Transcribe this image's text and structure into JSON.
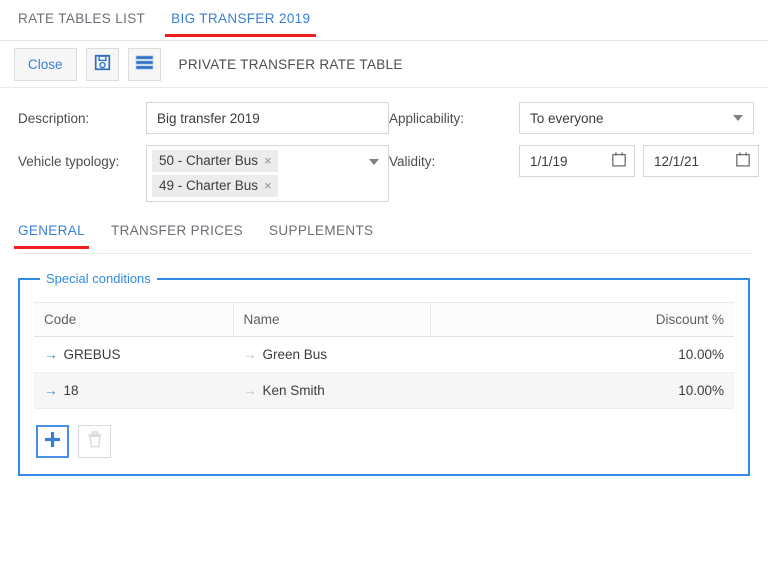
{
  "top_tabs": [
    {
      "label": "RATE TABLES LIST",
      "active": false
    },
    {
      "label": "BIG TRANSFER 2019",
      "active": true
    }
  ],
  "toolbar": {
    "close_label": "Close",
    "save_icon": "save-floppy-icon",
    "menu_icon": "hamburger-menu-icon",
    "title": "PRIVATE TRANSFER RATE TABLE"
  },
  "form": {
    "description_label": "Description:",
    "description_value": "Big transfer 2019",
    "vehicle_typology_label": "Vehicle typology:",
    "vehicle_chips": [
      {
        "label": "50 - Charter Bus",
        "remove": "×"
      },
      {
        "label": "49 - Charter Bus",
        "remove": "×"
      }
    ],
    "applicability_label": "Applicability:",
    "applicability_value": "To everyone",
    "validity_label": "Validity:",
    "validity_from": "1/1/19",
    "validity_to": "12/1/21"
  },
  "inner_tabs": [
    {
      "label": "GENERAL",
      "active": true
    },
    {
      "label": "TRANSFER PRICES",
      "active": false
    },
    {
      "label": "SUPPLEMENTS",
      "active": false
    }
  ],
  "special_conditions": {
    "legend": "Special conditions",
    "columns": [
      "Code",
      "Name",
      "",
      "Discount %"
    ],
    "rows": [
      {
        "code": "GREBUS",
        "name": "Green Bus",
        "discount": "10.00%"
      },
      {
        "code": "18",
        "name": "Ken Smith",
        "discount": "10.00%"
      }
    ],
    "row_arrow": "→",
    "add_label": "+",
    "delete_icon": "trash-icon"
  },
  "colors": {
    "accent_blue": "#3a7fd5",
    "fieldset_blue": "#2e8ae6",
    "tab_underline_red": "#f01f1f"
  }
}
